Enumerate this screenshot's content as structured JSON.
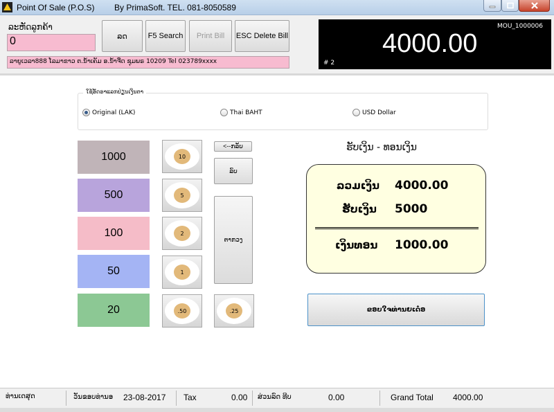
{
  "window": {
    "title": "Point Of Sale (P.O.S)",
    "vendor": "By PrimaSoft. TEL. 081-8050589"
  },
  "header": {
    "customer_label": "ລະຫັດລູກຄ້າ",
    "customer_value": "0",
    "buttons": {
      "cut": "ລດ",
      "search": "F5 Search",
      "print": "Print Bill",
      "delete": "ESC Delete Bill"
    },
    "address": "ລາຍູເວລາ888 ໂລມາຂາວ ຕ.ນ້ຳເຄັມ ອ.ນ້ຳຈືດ ຊຸມພຣ 10209 Tel 023789xxxx"
  },
  "display": {
    "code": "MOU_1000006",
    "total": "4000.00",
    "number": "# 2"
  },
  "currency": {
    "legend": "ໃຊ້ອັດຣາແລກປ່ຽນເງິນຕາ",
    "options": [
      {
        "label": "Original (LAK)",
        "checked": true
      },
      {
        "label": "Thai BAHT",
        "checked": false
      },
      {
        "label": "USD Dollar",
        "checked": false
      }
    ]
  },
  "bills": [
    {
      "label": "1000",
      "color": "#c0b4b8"
    },
    {
      "label": "500",
      "color": "#b8a4dc"
    },
    {
      "label": "100",
      "color": "#f5bcc8"
    },
    {
      "label": "50",
      "color": "#a4b4f4"
    },
    {
      "label": "20",
      "color": "#8cc894"
    }
  ],
  "coins": [
    "10",
    "5",
    "2",
    "1",
    ".50",
    ".25"
  ],
  "actions": {
    "back": "<--ກລັບ",
    "delete": "ລົບ",
    "exact": "ຕາກວງ"
  },
  "summary": {
    "title": "ຮັບເງິນ - ທອນເງິນ",
    "total_label": "ລວມເງິນ",
    "total_value": "4000.00",
    "received_label": "ຮັບເງິນ",
    "received_value": "5000",
    "change_label": "ເງິນທອນ",
    "change_value": "1000.00",
    "thanks": "ຂອບໃຈທ່ານຍເດ໋ອ"
  },
  "status": {
    "item1": "ທ່ານເດສຸດ",
    "date_label": "ວັນຂອບທ່ານອ",
    "date_value": "23-08-2017",
    "tax_label": "Tax",
    "tax_value": "0.00",
    "discount_label": "ສ່ວນລົດ ທີບ",
    "discount_value": "0.00",
    "grand_label": "Grand Total",
    "grand_value": "4000.00"
  }
}
